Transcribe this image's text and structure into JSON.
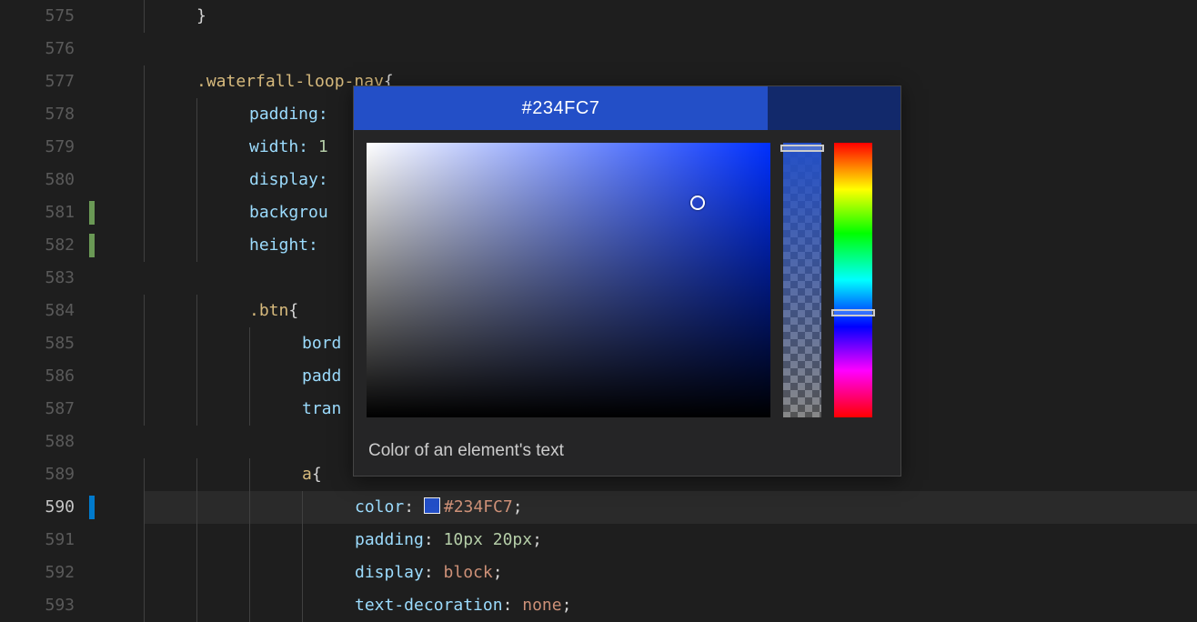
{
  "gutter": {
    "start": 575,
    "end": 593,
    "current": 590,
    "markers": [
      {
        "line": 581,
        "color": "green"
      },
      {
        "line": 582,
        "color": "green"
      },
      {
        "line": 590,
        "color": "blue"
      }
    ]
  },
  "code": {
    "lines": [
      {
        "n": 575,
        "indent": 1,
        "tokens": [
          {
            "t": "}",
            "c": "brace"
          }
        ]
      },
      {
        "n": 576,
        "indent": 0,
        "tokens": []
      },
      {
        "n": 577,
        "indent": 1,
        "tokens": [
          {
            "t": ".waterfall-loop-nav",
            "c": "sel"
          },
          {
            "t": "{",
            "c": "brace"
          }
        ]
      },
      {
        "n": 578,
        "indent": 2,
        "tokens": [
          {
            "t": "padding:",
            "c": "prop"
          }
        ]
      },
      {
        "n": 579,
        "indent": 2,
        "tokens": [
          {
            "t": "width:",
            "c": "prop"
          },
          {
            "t": " ",
            "c": ""
          },
          {
            "t": "1",
            "c": "num"
          }
        ]
      },
      {
        "n": 580,
        "indent": 2,
        "tokens": [
          {
            "t": "display:",
            "c": "prop"
          }
        ]
      },
      {
        "n": 581,
        "indent": 2,
        "tokens": [
          {
            "t": "backgrou",
            "c": "prop"
          }
        ]
      },
      {
        "n": 582,
        "indent": 2,
        "tokens": [
          {
            "t": "height:",
            "c": "prop"
          }
        ]
      },
      {
        "n": 583,
        "indent": 0,
        "tokens": []
      },
      {
        "n": 584,
        "indent": 2,
        "tokens": [
          {
            "t": ".btn",
            "c": "sel"
          },
          {
            "t": "{",
            "c": "brace"
          }
        ]
      },
      {
        "n": 585,
        "indent": 3,
        "tokens": [
          {
            "t": "bord",
            "c": "prop"
          }
        ]
      },
      {
        "n": 586,
        "indent": 3,
        "tokens": [
          {
            "t": "padd",
            "c": "prop"
          }
        ]
      },
      {
        "n": 587,
        "indent": 3,
        "tokens": [
          {
            "t": "tran",
            "c": "prop"
          }
        ]
      },
      {
        "n": 588,
        "indent": 0,
        "tokens": []
      },
      {
        "n": 589,
        "indent": 3,
        "tokens": [
          {
            "t": "a",
            "c": "sel"
          },
          {
            "t": "{",
            "c": "brace"
          }
        ]
      },
      {
        "n": 590,
        "indent": 4,
        "tokens": [
          {
            "t": "color",
            "c": "prop"
          },
          {
            "t": ": ",
            "c": "punct"
          },
          {
            "swatch": "#234FC7"
          },
          {
            "t": "#234FC7",
            "c": "val"
          },
          {
            "t": ";",
            "c": "punct"
          }
        ]
      },
      {
        "n": 591,
        "indent": 4,
        "tokens": [
          {
            "t": "padding",
            "c": "prop"
          },
          {
            "t": ": ",
            "c": "punct"
          },
          {
            "t": "10px",
            "c": "num"
          },
          {
            "t": " ",
            "c": ""
          },
          {
            "t": "20px",
            "c": "num"
          },
          {
            "t": ";",
            "c": "punct"
          }
        ]
      },
      {
        "n": 592,
        "indent": 4,
        "tokens": [
          {
            "t": "display",
            "c": "prop"
          },
          {
            "t": ": ",
            "c": "punct"
          },
          {
            "t": "block",
            "c": "val"
          },
          {
            "t": ";",
            "c": "punct"
          }
        ]
      },
      {
        "n": 593,
        "indent": 4,
        "tokens": [
          {
            "t": "text-decoration",
            "c": "prop"
          },
          {
            "t": ": ",
            "c": "punct"
          },
          {
            "t": "none",
            "c": "val"
          },
          {
            "t": ";",
            "c": "punct"
          }
        ]
      }
    ]
  },
  "picker": {
    "title": "#234FC7",
    "footer": "Color of an element's text",
    "color": "#234FC7"
  }
}
